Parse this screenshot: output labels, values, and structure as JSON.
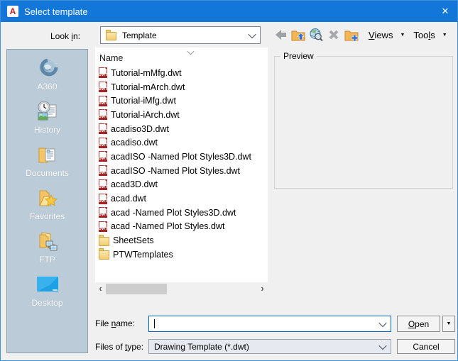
{
  "window": {
    "title": "Select template",
    "app_icon_letter": "A",
    "close_glyph": "✕"
  },
  "toolbar": {
    "look_in_label": {
      "pre": "Look ",
      "key": "i",
      "post": "n:"
    },
    "look_in_value": "Template",
    "views": {
      "pre": "",
      "key": "V",
      "post": "iews"
    },
    "tools": {
      "pre": "Too",
      "key": "l",
      "post": "s"
    },
    "dropdown_glyph": "▼",
    "icon_names": [
      "back-icon",
      "up-one-level-icon",
      "search-the-web-icon",
      "delete-icon",
      "create-new-folder-icon"
    ]
  },
  "sidebar": {
    "items": [
      {
        "label": "A360",
        "icon": "a360"
      },
      {
        "label": "History",
        "icon": "history"
      },
      {
        "label": "Documents",
        "icon": "documents"
      },
      {
        "label": "Favorites",
        "icon": "favorites"
      },
      {
        "label": "FTP",
        "icon": "ftp"
      },
      {
        "label": "Desktop",
        "icon": "desktop"
      }
    ]
  },
  "file_list": {
    "column_header": "Name",
    "files": [
      {
        "name": "Tutorial-mMfg.dwt",
        "kind": "dwt"
      },
      {
        "name": "Tutorial-mArch.dwt",
        "kind": "dwt"
      },
      {
        "name": "Tutorial-iMfg.dwt",
        "kind": "dwt"
      },
      {
        "name": "Tutorial-iArch.dwt",
        "kind": "dwt"
      },
      {
        "name": "acadiso3D.dwt",
        "kind": "dwt"
      },
      {
        "name": "acadiso.dwt",
        "kind": "dwt"
      },
      {
        "name": "acadISO -Named Plot Styles3D.dwt",
        "kind": "dwt"
      },
      {
        "name": "acadISO -Named Plot Styles.dwt",
        "kind": "dwt"
      },
      {
        "name": "acad3D.dwt",
        "kind": "dwt"
      },
      {
        "name": "acad.dwt",
        "kind": "dwt"
      },
      {
        "name": "acad -Named Plot Styles3D.dwt",
        "kind": "dwt"
      },
      {
        "name": "acad -Named Plot Styles.dwt",
        "kind": "dwt"
      },
      {
        "name": "SheetSets",
        "kind": "folder"
      },
      {
        "name": "PTWTemplates",
        "kind": "folder"
      }
    ],
    "scrollbar": {
      "left_glyph": "‹",
      "right_glyph": "›"
    }
  },
  "preview": {
    "label": "Preview"
  },
  "footer": {
    "file_name_label": {
      "pre": "File ",
      "key": "n",
      "post": "ame:"
    },
    "file_name_value": "",
    "files_of_type_label": {
      "pre": "Files of ",
      "key": "t",
      "post": "ype:"
    },
    "files_of_type_value": "Drawing Template (*.dwt)",
    "open_label": {
      "pre": "",
      "key": "O",
      "post": "pen"
    },
    "open_dropdown_glyph": "▼",
    "cancel_label": "Cancel"
  },
  "icons": {
    "dwt_badge": "DWT"
  },
  "colors": {
    "titlebar": "#1376d9",
    "dialog_border": "#3f8fd6",
    "sidebar_bg": "#bccbd8",
    "focus_border": "#0067c0",
    "dwt_red": "#b23535",
    "folder_yellow": "#f1cd74",
    "scroll_thumb": "#cdcdcd"
  }
}
